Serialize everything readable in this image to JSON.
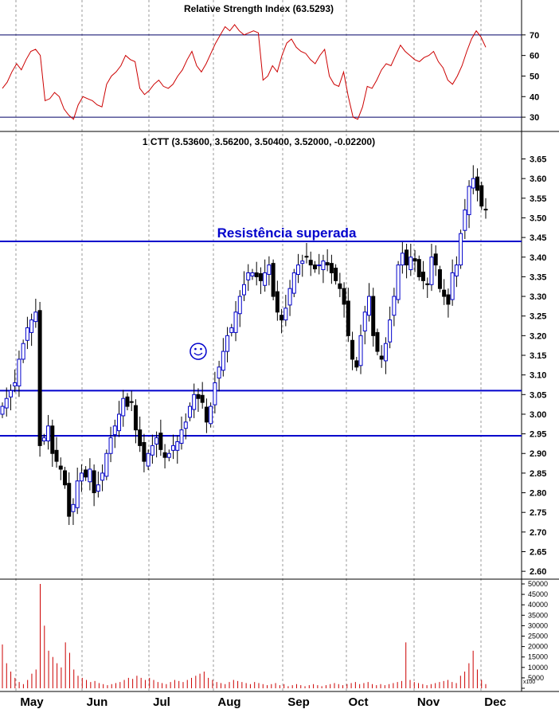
{
  "chart_data": [
    {
      "type": "line",
      "title": "Relative Strength Index (63.5293)",
      "ylim": [
        25,
        80
      ],
      "yticks": [
        30,
        40,
        50,
        60,
        70
      ],
      "levels": [
        30,
        70
      ],
      "line_color": "#cc0000",
      "series": [
        {
          "values": [
            44,
            47,
            52,
            56,
            53,
            58,
            62,
            63,
            60,
            38,
            39,
            42,
            40,
            34,
            31,
            29,
            36,
            40,
            39,
            38,
            36,
            35,
            46,
            50,
            52,
            55,
            60,
            58,
            57,
            44,
            41,
            43,
            46,
            48,
            45,
            44,
            46,
            50,
            53,
            58,
            62,
            55,
            52,
            56,
            61,
            66,
            70,
            74,
            72,
            75,
            72,
            70,
            71,
            72,
            71,
            48,
            50,
            55,
            52,
            60,
            66,
            68,
            64,
            62,
            61,
            58,
            56,
            60,
            63,
            50,
            46,
            45,
            52,
            40,
            30,
            29,
            35,
            45,
            44,
            48,
            53,
            56,
            55,
            60,
            65,
            62,
            60,
            58,
            57,
            59,
            60,
            62,
            57,
            54,
            48,
            46,
            50,
            55,
            62,
            68,
            72,
            69,
            64
          ]
        }
      ]
    },
    {
      "type": "candlestick",
      "title": "1 CTT (3.53600, 3.56200, 3.50400, 3.52000, -0.02200)",
      "annotation": "Resistência superada",
      "annotation_color": "#0000cc",
      "ylim": [
        2.58,
        3.72
      ],
      "yticks": [
        "3.65",
        "3.60",
        "3.55",
        "3.50",
        "3.45",
        "3.40",
        "3.35",
        "3.30",
        "3.25",
        "3.20",
        "3.15",
        "3.10",
        "3.05",
        "3.00",
        "2.95",
        "2.90",
        "2.85",
        "2.80",
        "2.75",
        "2.70",
        "2.65",
        "2.60"
      ],
      "resistance_levels": [
        3.44,
        3.06,
        2.945
      ],
      "marker": "smiley",
      "marker_index": 47,
      "marker_value": 3.16,
      "closes": [
        3.02,
        3.04,
        3.06,
        3.08,
        3.14,
        3.18,
        3.22,
        3.24,
        3.26,
        2.92,
        2.94,
        2.97,
        2.9,
        2.88,
        2.86,
        2.82,
        2.74,
        2.77,
        2.83,
        2.85,
        2.84,
        2.86,
        2.8,
        2.82,
        2.85,
        2.9,
        2.94,
        2.97,
        3.0,
        3.04,
        3.02,
        3.03,
        2.96,
        2.92,
        2.88,
        2.9,
        2.92,
        2.94,
        2.91,
        2.89,
        2.9,
        2.92,
        2.93,
        2.96,
        2.98,
        3.02,
        3.05,
        3.04,
        3.03,
        2.98,
        3.02,
        3.08,
        3.12,
        3.16,
        3.2,
        3.22,
        3.26,
        3.3,
        3.33,
        3.36,
        3.36,
        3.35,
        3.34,
        3.36,
        3.38,
        3.3,
        3.26,
        3.24,
        3.27,
        3.32,
        3.36,
        3.38,
        3.39,
        3.4,
        3.38,
        3.37,
        3.38,
        3.39,
        3.38,
        3.36,
        3.34,
        3.32,
        3.28,
        3.2,
        3.14,
        3.12,
        3.2,
        3.26,
        3.3,
        3.2,
        3.16,
        3.14,
        3.18,
        3.24,
        3.3,
        3.38,
        3.41,
        3.38,
        3.4,
        3.39,
        3.35,
        3.34,
        3.33,
        3.4,
        3.38,
        3.32,
        3.3,
        3.28,
        3.36,
        3.38,
        3.46,
        3.52,
        3.58,
        3.6,
        3.57,
        3.53,
        3.52
      ]
    },
    {
      "type": "bar",
      "ylim": [
        0,
        50000
      ],
      "yticks": [
        "50000",
        "45000",
        "40000",
        "35000",
        "30000",
        "25000",
        "20000",
        "15000",
        "10000",
        "5000",
        "0"
      ],
      "unit_label": "x100",
      "bar_color": "#cc0000",
      "values": [
        21000,
        12000,
        8000,
        5000,
        3000,
        2000,
        4000,
        7000,
        9000,
        50000,
        30000,
        18000,
        15000,
        12000,
        10000,
        22000,
        17000,
        9000,
        6000,
        5000,
        4000,
        3000,
        3500,
        2500,
        2000,
        1500,
        2000,
        2500,
        3000,
        4000,
        5000,
        4500,
        6000,
        5000,
        4000,
        5000,
        4000,
        3000,
        2500,
        2000,
        3000,
        4000,
        3500,
        3000,
        4000,
        5000,
        6000,
        7000,
        8000,
        5000,
        4000,
        3000,
        2500,
        2000,
        3000,
        4000,
        3500,
        3000,
        2500,
        2000,
        3000,
        2500,
        2000,
        1500,
        2000,
        2500,
        1500,
        2000,
        1000,
        1500,
        2000,
        1500,
        1000,
        1500,
        2000,
        1500,
        1000,
        1500,
        2000,
        2500,
        2000,
        1500,
        2000,
        2500,
        3000,
        2000,
        2500,
        3000,
        2000,
        1500,
        2000,
        1500,
        2000,
        2500,
        3000,
        3500,
        22000,
        4000,
        3000,
        2500,
        2000,
        1500,
        2000,
        2500,
        3000,
        3500,
        4000,
        3000,
        2500,
        6000,
        8000,
        12000,
        18000,
        9000,
        4000,
        2000
      ]
    }
  ],
  "months": [
    "May",
    "Jun",
    "Jul",
    "Aug",
    "Sep",
    "Oct",
    "Nov",
    "Dec"
  ]
}
